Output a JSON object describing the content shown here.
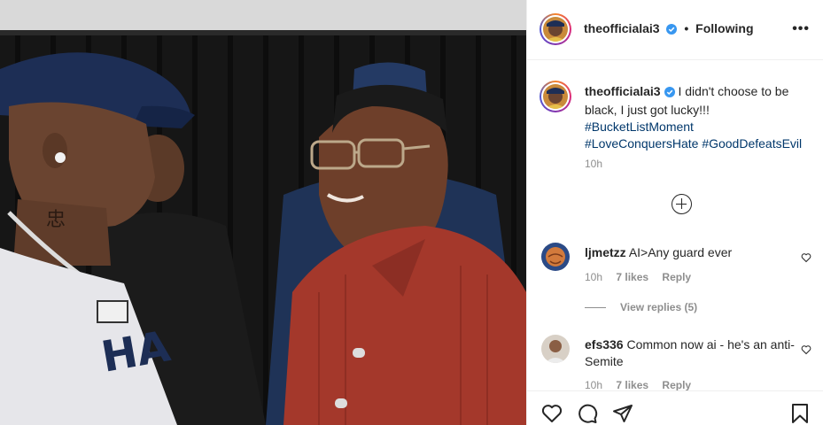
{
  "post": {
    "username": "theofficialai3",
    "follow_status": "Following",
    "more_label": "•••",
    "caption": {
      "text": "I didn't choose to be black, I just got lucky!!!",
      "hashtags": [
        "#BucketListMoment",
        "#LoveConquersHate",
        "#GoodDefeatsEvil"
      ]
    },
    "time": "10h"
  },
  "comments": [
    {
      "username": "ljmetzz",
      "text": "AI>Any guard ever",
      "time": "10h",
      "likes": "7 likes",
      "reply": "Reply",
      "view_replies": "View replies (5)"
    },
    {
      "username": "efs336",
      "text": "Common now ai - he's an anti-Semite",
      "time": "10h",
      "likes": "7 likes",
      "reply": "Reply"
    }
  ],
  "colors": {
    "verified": "#3897f0",
    "hashtag": "#00376b",
    "secondary_text": "#8e8e8e",
    "border": "#efefef"
  },
  "icons": [
    "verified-badge-icon",
    "more-options-icon",
    "load-more-comments-icon",
    "like-heart-icon",
    "comment-bubble-icon",
    "share-paper-plane-icon",
    "save-bookmark-icon",
    "comment-like-heart-icon"
  ]
}
